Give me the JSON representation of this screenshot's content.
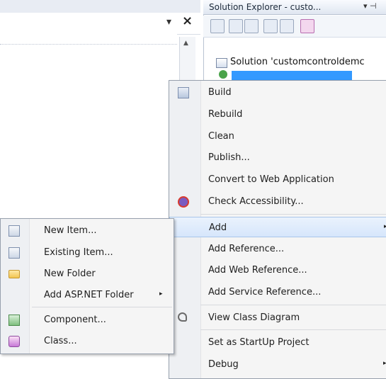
{
  "editor": {
    "dropdown_glyph": "▾",
    "close_glyph": "×",
    "scroll_up_glyph": "▲"
  },
  "solution_explorer": {
    "title": "Solution Explorer - custo...",
    "pin_glyph": "▾ ⊣",
    "solution_label": "Solution 'customcontroldemc",
    "toolbar_icons": [
      "properties-icon",
      "show-all-files-icon",
      "refresh-icon",
      "view-code-icon",
      "view-designer-icon",
      "class-diagram-icon"
    ]
  },
  "context_menu": {
    "items": [
      {
        "label": "Build",
        "icon": "build-icon"
      },
      {
        "label": "Rebuild",
        "icon": ""
      },
      {
        "label": "Clean",
        "icon": ""
      },
      {
        "label": "Publish...",
        "icon": ""
      },
      {
        "label": "Convert to Web Application",
        "icon": ""
      },
      {
        "label": "Check Accessibility...",
        "icon": "accessibility-icon"
      },
      {
        "label": "Add",
        "icon": "",
        "highlighted": true,
        "has_submenu": true
      },
      {
        "label": "Add Reference...",
        "icon": ""
      },
      {
        "label": "Add Web Reference...",
        "icon": ""
      },
      {
        "label": "Add Service Reference...",
        "icon": ""
      },
      {
        "label": "View Class Diagram",
        "icon": "class-diagram-icon"
      },
      {
        "label": "Set as StartUp Project",
        "icon": ""
      },
      {
        "label": "Debug",
        "icon": "",
        "has_submenu": true
      }
    ],
    "submenu_arrow": "▸"
  },
  "add_submenu": {
    "items": [
      {
        "label": "New Item...",
        "icon": "new-item-icon"
      },
      {
        "label": "Existing Item...",
        "icon": "existing-item-icon"
      },
      {
        "label": "New Folder",
        "icon": "folder-icon"
      },
      {
        "label": "Add ASP.NET Folder",
        "icon": "",
        "has_submenu": true
      },
      {
        "label": "Component...",
        "icon": "component-icon"
      },
      {
        "label": "Class...",
        "icon": "class-icon"
      }
    ],
    "submenu_arrow": "▸"
  },
  "colors": {
    "selection": "#3399ff",
    "menu_bg": "#f5f5f5",
    "highlight_border": "#a9c6ea"
  }
}
